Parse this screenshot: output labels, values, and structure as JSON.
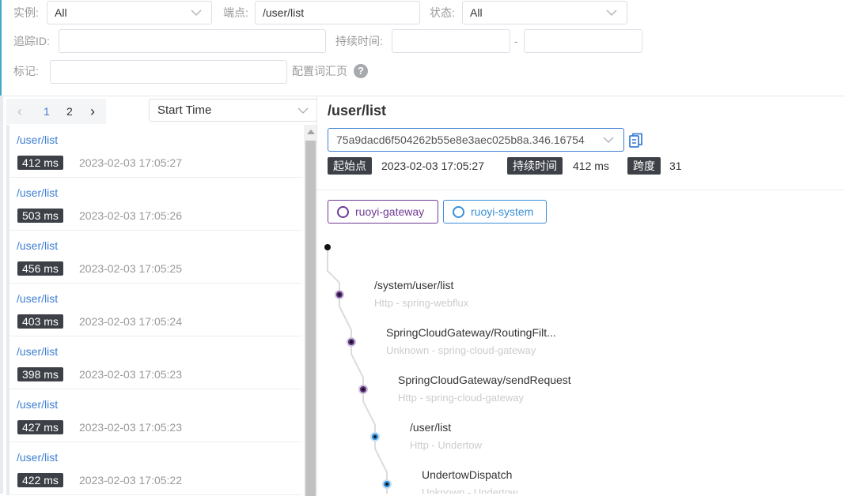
{
  "filters": {
    "instance_label": "实例:",
    "instance_value": "All",
    "endpoint_label": "端点:",
    "endpoint_value": "/user/list",
    "status_label": "状态:",
    "status_value": "All",
    "trace_id_label": "追踪ID:",
    "trace_id_value": "",
    "duration_label": "持续时间:",
    "duration_min": "",
    "duration_sep": "-",
    "duration_max": "",
    "tags_label": "标记:",
    "tags_value": "",
    "config_link": "配置词汇页",
    "help_icon": "?"
  },
  "pagination": {
    "prev": "‹",
    "pages": [
      "1",
      "2"
    ],
    "current": "1",
    "next": "›"
  },
  "sort": {
    "value": "Start Time"
  },
  "traces": [
    {
      "endpoint": "/user/list",
      "duration": "412 ms",
      "time": "2023-02-03 17:05:27"
    },
    {
      "endpoint": "/user/list",
      "duration": "503 ms",
      "time": "2023-02-03 17:05:26"
    },
    {
      "endpoint": "/user/list",
      "duration": "456 ms",
      "time": "2023-02-03 17:05:25"
    },
    {
      "endpoint": "/user/list",
      "duration": "403 ms",
      "time": "2023-02-03 17:05:24"
    },
    {
      "endpoint": "/user/list",
      "duration": "398 ms",
      "time": "2023-02-03 17:05:23"
    },
    {
      "endpoint": "/user/list",
      "duration": "427 ms",
      "time": "2023-02-03 17:05:23"
    },
    {
      "endpoint": "/user/list",
      "duration": "422 ms",
      "time": "2023-02-03 17:05:22"
    }
  ],
  "detail": {
    "title": "/user/list",
    "trace_id": "75a9dacd6f504262b55e8e3aec025b8a.346.16754",
    "start_label": "起始点",
    "start_value": "2023-02-03 17:05:27",
    "duration_label": "持续时间",
    "duration_value": "412 ms",
    "span_label": "跨度",
    "span_value": "31"
  },
  "services": [
    {
      "name": "ruoyi-gateway",
      "color": "#6f3b93"
    },
    {
      "name": "ruoyi-system",
      "color": "#3a8fd6"
    }
  ],
  "spans": [
    {
      "name": "/system/user/list",
      "sub": "Http - spring-webflux",
      "color": "#5b2d82"
    },
    {
      "name": "SpringCloudGateway/RoutingFilt...",
      "sub": "Unknown - spring-cloud-gateway",
      "color": "#5b2d82"
    },
    {
      "name": "SpringCloudGateway/sendRequest",
      "sub": "Http - spring-cloud-gateway",
      "color": "#5b2d82"
    },
    {
      "name": "/user/list",
      "sub": "Http - Undertow",
      "color": "#2f8fd8"
    },
    {
      "name": "UndertowDispatch",
      "sub": "Unknown - Undertow",
      "color": "#2f8fd8"
    }
  ]
}
